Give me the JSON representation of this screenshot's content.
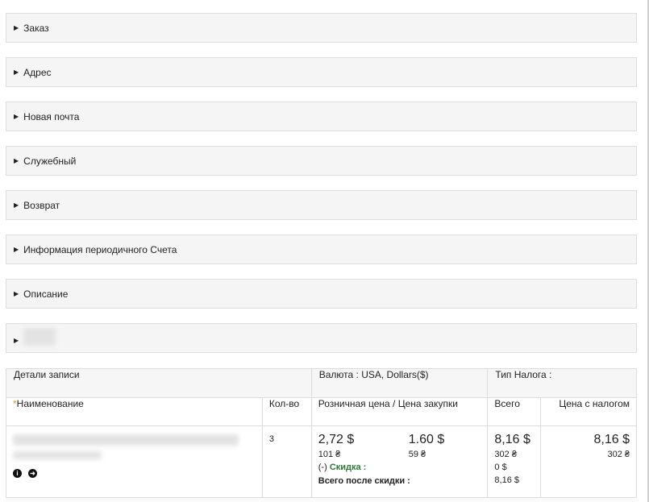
{
  "panels": [
    {
      "label": "Заказ"
    },
    {
      "label": "Адрес"
    },
    {
      "label": "Новая почта"
    },
    {
      "label": "Служебный"
    },
    {
      "label": "Возврат"
    },
    {
      "label": "Информация периодичного Счета"
    },
    {
      "label": "Описание"
    },
    {
      "label": ""
    }
  ],
  "table": {
    "record_details": "Детали записи",
    "currency": "Валюта : USA, Dollars($)",
    "tax_type": "Тип Налога :",
    "columns": {
      "name_star": "*",
      "name": "Наименование",
      "qty": "Кол-во",
      "price": "Розничная цена / Цена закупки",
      "total": "Всего",
      "price_with_tax": "Цена с налогом"
    },
    "row": {
      "qty": "3",
      "retail_price": "2,72 $",
      "retail_price_uah": "101 ₴",
      "purchase_price": "1.60 $",
      "purchase_price_uah": "59 ₴",
      "discount_prefix": "(-)",
      "discount_label": "Скидка :",
      "after_discount_label": "Всего после скидки :",
      "total": "8,16 $",
      "total_uah": "302 ₴",
      "discount_value": "0 $",
      "after_discount_value": "8,16 $",
      "price_with_tax": "8,16 $",
      "price_with_tax_uah": "302 ₴"
    }
  },
  "icons": [
    "info-icon",
    "arrow-right-icon"
  ]
}
